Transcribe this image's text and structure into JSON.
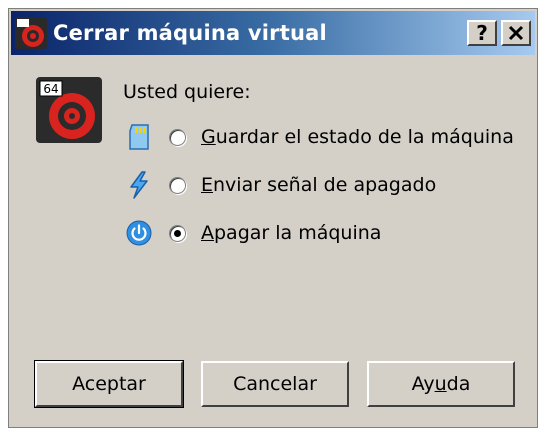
{
  "window": {
    "title": "Cerrar máquina virtual",
    "help_label": "?",
    "close_label": "✕"
  },
  "prompt": "Usted quiere:",
  "options": [
    {
      "label_first": "G",
      "label_rest": "uardar el estado de la máquina",
      "selected": false,
      "icon": "sd-card-icon"
    },
    {
      "label_first": "E",
      "label_rest": "nviar señal de apagado",
      "selected": false,
      "icon": "lightning-icon"
    },
    {
      "label_first": "A",
      "label_rest": "pagar la máquina",
      "selected": true,
      "icon": "power-icon"
    }
  ],
  "buttons": {
    "accept": "Aceptar",
    "cancel": "Cancelar",
    "help_pre": "Ay",
    "help_ul": "u",
    "help_post": "da"
  },
  "logo": {
    "badge": "64"
  },
  "colors": {
    "accent": "#0a246a",
    "brand": "#d9231f"
  }
}
